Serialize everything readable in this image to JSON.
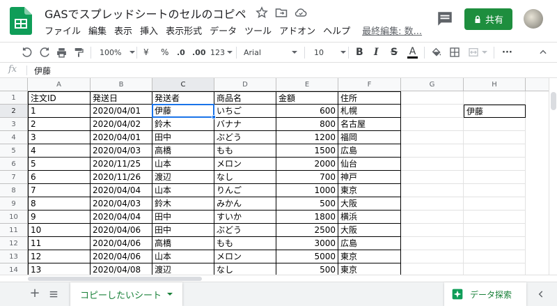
{
  "header": {
    "title": "GASでスプレッドシートのセルのコピペ",
    "menu": [
      "ファイル",
      "編集",
      "表示",
      "挿入",
      "表示形式",
      "データ",
      "ツール",
      "アドオン",
      "ヘルプ"
    ],
    "last_edit": "最終編集: 数...",
    "share_label": "共有",
    "icons": [
      "sheets-logo",
      "star-icon",
      "move-to-folder-icon",
      "cloud-status-icon",
      "comment-icon",
      "lock-icon",
      "avatar"
    ]
  },
  "toolbar": {
    "zoom": "100%",
    "currency": "¥",
    "percent": "%",
    "decrease_decimal": ".0",
    "increase_decimal": ".00",
    "number_format": "123",
    "font": "Arial",
    "font_size": "10",
    "bold": "B",
    "italic": "I",
    "strikethrough": "S",
    "text_color": "A",
    "more": "···"
  },
  "formula_bar": {
    "fx": "fx",
    "value": "伊藤"
  },
  "grid": {
    "columns": [
      "A",
      "B",
      "C",
      "D",
      "E",
      "F",
      "G",
      "H"
    ],
    "selected_column": "C",
    "selected_row": "2",
    "row_numbers": [
      "1",
      "2",
      "3",
      "4",
      "5",
      "6",
      "7",
      "8",
      "9",
      "10",
      "11",
      "12",
      "13",
      "14"
    ],
    "rows": [
      [
        "注文ID",
        "発送日",
        "発送者",
        "商品名",
        "金額",
        "住所"
      ],
      [
        "1",
        "2020/04/01",
        "伊藤",
        "いちご",
        "600",
        "札幌"
      ],
      [
        "2",
        "2020/04/02",
        "鈴木",
        "バナナ",
        "800",
        "名古屋"
      ],
      [
        "3",
        "2020/04/01",
        "田中",
        "ぶどう",
        "1200",
        "福岡"
      ],
      [
        "4",
        "2020/04/03",
        "高橋",
        "もも",
        "1500",
        "広島"
      ],
      [
        "5",
        "2020/11/25",
        "山本",
        "メロン",
        "2000",
        "仙台"
      ],
      [
        "6",
        "2020/11/26",
        "渡辺",
        "なし",
        "700",
        "神戸"
      ],
      [
        "7",
        "2020/04/04",
        "山本",
        "りんご",
        "1000",
        "東京"
      ],
      [
        "8",
        "2020/04/03",
        "鈴木",
        "みかん",
        "500",
        "大阪"
      ],
      [
        "9",
        "2020/04/04",
        "田中",
        "すいか",
        "1800",
        "横浜"
      ],
      [
        "10",
        "2020/04/06",
        "田中",
        "ぶどう",
        "2500",
        "大阪"
      ],
      [
        "11",
        "2020/04/06",
        "高橋",
        "もも",
        "3000",
        "広島"
      ],
      [
        "12",
        "2020/04/06",
        "山本",
        "メロン",
        "5000",
        "東京"
      ],
      [
        "13",
        "2020/04/08",
        "渡辺",
        "なし",
        "500",
        "東京"
      ]
    ],
    "h2_value": "伊藤"
  },
  "sheet_bar": {
    "active_sheet": "コピーしたいシート",
    "explore_label": "データ探索"
  },
  "colors": {
    "accent_green": "#1e8e3e",
    "selection_blue": "#1a73e8",
    "sheet_tab_green": "#188038"
  }
}
